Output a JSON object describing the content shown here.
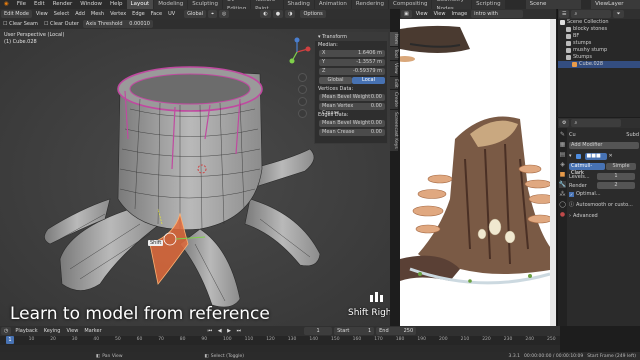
{
  "topbar": {
    "menus": [
      "File",
      "Edit",
      "Render",
      "Window",
      "Help"
    ],
    "workspaces": [
      "Layout",
      "Modeling",
      "Sculpting",
      "UV Editing",
      "Texture Paint",
      "Shading",
      "Animation",
      "Rendering",
      "Compositing",
      "Geometry Nodes",
      "Scripting"
    ],
    "scene_label": "Scene",
    "view_layer_label": "ViewLayer"
  },
  "viewport": {
    "mode": "Edit Mode",
    "menus": [
      "View",
      "Select",
      "Add",
      "Mesh",
      "Vertex",
      "Edge",
      "Face",
      "UV"
    ],
    "orientation": "Global",
    "options_label": "Options",
    "line2": {
      "clear_seam": "Clear Seam",
      "clear_outer": "Clear Outer",
      "axis_threshold_label": "Axis Threshold",
      "axis_threshold_value": "0.00010"
    },
    "view_label": "User Perspective (Local)",
    "object_label": "(1) Cube.028",
    "shortcut_label": "Shift",
    "overlay_title": "Learn to model from reference",
    "key_hint": "Shift Right"
  },
  "npanel": {
    "section": "Transform",
    "median_label": "Median:",
    "x": {
      "label": "X",
      "value": "1.6406 m"
    },
    "y": {
      "label": "Y",
      "value": "-1.3557 m"
    },
    "z": {
      "label": "Z",
      "value": "-0.59379 m"
    },
    "global_label": "Global",
    "local_label": "Local",
    "vertices_data": "Vertices Data:",
    "mean_bevel_weight_label": "Mean Bevel Weight",
    "mean_bevel_weight_value": "0.00",
    "mean_vertex_crease_label": "Mean Vertex Crease",
    "mean_vertex_crease_value": "0.00",
    "edges_data": "Edges Data:",
    "edge_bevel_weight_label": "Mean Bevel Weight",
    "edge_bevel_weight_value": "0.00",
    "mean_crease_label": "Mean Crease",
    "mean_crease_value": "0.00",
    "tabs": [
      "Item",
      "Tool",
      "View",
      "Edit",
      "Create",
      "Screencast Keys"
    ]
  },
  "image_editor": {
    "menus": [
      "View",
      "View",
      "Image"
    ],
    "image_name": "intro with francisco"
  },
  "outliner": {
    "root": "Scene Collection",
    "items": [
      {
        "label": "blocky stones",
        "selected": false
      },
      {
        "label": "BF",
        "selected": false
      },
      {
        "label": "stumps",
        "selected": false
      },
      {
        "label": "mushy stump",
        "selected": false
      },
      {
        "label": "Stumps",
        "selected": false
      },
      {
        "label": "Cube.028",
        "selected": true
      }
    ]
  },
  "properties": {
    "object_name": "Cu",
    "modifier_short": "Subd",
    "add_modifier": "Add Modifier",
    "catmull": "Catmull-Clark",
    "simple": "Simple",
    "levels_label": "Levels...",
    "levels_value": "1",
    "render_label": "Render",
    "render_value": "2",
    "optimal_label": "Optimal...",
    "autosmooth_label": "Autosmooth or custo...",
    "advanced_label": "Advanced"
  },
  "timeline": {
    "menus": [
      "Playback",
      "Keying",
      "View",
      "Marker"
    ],
    "current_frame": "1",
    "start_label": "Start",
    "start_value": "1",
    "end_label": "End",
    "end_value": "250",
    "ticks": [
      "0",
      "10",
      "20",
      "30",
      "40",
      "50",
      "60",
      "70",
      "80",
      "90",
      "100",
      "110",
      "120",
      "130",
      "140",
      "150",
      "160",
      "170",
      "180",
      "190",
      "200",
      "210",
      "220",
      "230",
      "240",
      "250"
    ]
  },
  "statusbar": {
    "pan_view": "Pan View",
    "select_toggle": "Select (Toggle)",
    "version": "3.3.1",
    "timecode": "00:00:00:00 / 00:00:10:09",
    "start_frame": "Start Frame (249 left)"
  },
  "colors": {
    "accent": "#4772b3",
    "selected_row": "#334d80",
    "modifier_orange": "#e06a3b",
    "mesh_edge": "#c04aa0"
  }
}
